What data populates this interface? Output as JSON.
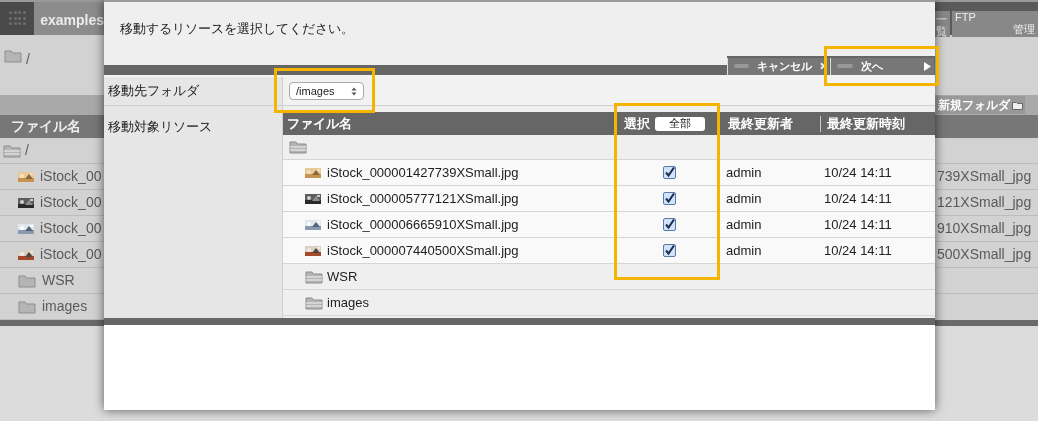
{
  "background": {
    "left": {
      "app_name": "examples",
      "path": "/",
      "column_header": "ファイル名",
      "root": "/",
      "rows": [
        {
          "kind": "file",
          "name": "iStock_00"
        },
        {
          "kind": "file",
          "name": "iStock_00"
        },
        {
          "kind": "file",
          "name": "iStock_00"
        },
        {
          "kind": "file",
          "name": "iStock_00"
        },
        {
          "kind": "folder",
          "name": "WSR"
        },
        {
          "kind": "folder",
          "name": "images"
        }
      ]
    },
    "right": {
      "nav": [
        {
          "label": "一覧"
        },
        {
          "title": "FTP",
          "label": "管理"
        }
      ],
      "new_folder_button": "新規フォルダ",
      "rows": [
        "739XSmall_jpg",
        "121XSmall_jpg",
        "910XSmall_jpg",
        "500XSmall_jpg"
      ]
    }
  },
  "dialog": {
    "message": "移動するリソースを選択してください。",
    "buttons": [
      {
        "kind": "cancel",
        "label": "キャンセル"
      },
      {
        "kind": "next",
        "label": "次へ"
      }
    ],
    "destination": {
      "label": "移動先フォルダ",
      "value": "/images"
    },
    "resources": {
      "label": "移動対象リソース",
      "columns": [
        "ファイル名",
        "選択",
        "最終更新者",
        "最終更新時刻"
      ],
      "select_all": "全部",
      "rows": [
        {
          "kind": "parent"
        },
        {
          "kind": "file",
          "name": "iStock_000001427739XSmall.jpg",
          "checked": true,
          "user": "admin",
          "time": "10/24 14:11"
        },
        {
          "kind": "file",
          "name": "iStock_000005777121XSmall.jpg",
          "checked": true,
          "user": "admin",
          "time": "10/24 14:11"
        },
        {
          "kind": "file",
          "name": "iStock_000006665910XSmall.jpg",
          "checked": true,
          "user": "admin",
          "time": "10/24 14:11"
        },
        {
          "kind": "file",
          "name": "iStock_000007440500XSmall.jpg",
          "checked": true,
          "user": "admin",
          "time": "10/24 14:11"
        },
        {
          "kind": "folder",
          "name": "WSR"
        },
        {
          "kind": "folder",
          "name": "images"
        }
      ]
    }
  }
}
